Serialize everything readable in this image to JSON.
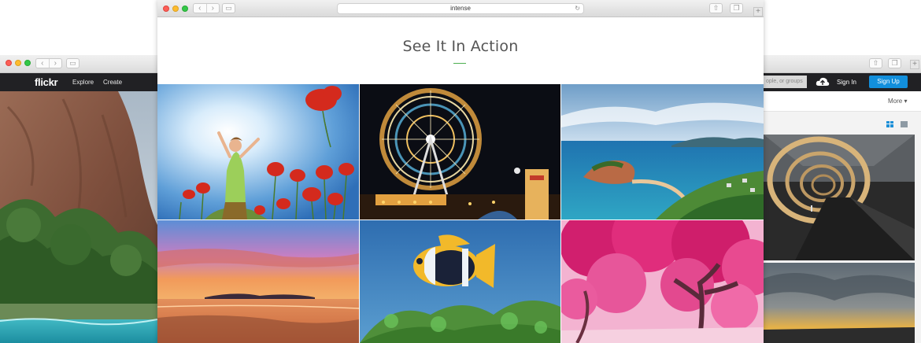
{
  "back_window": {
    "flickr": {
      "logo": "flickr",
      "nav": [
        "Explore",
        "Create"
      ],
      "search_placeholder": "ople, or groups",
      "sign_in": "Sign In",
      "sign_up": "Sign Up",
      "more": "More ▾"
    }
  },
  "front_window": {
    "url": "intense",
    "heading": "See It In Action",
    "accent_color": "#4caf50",
    "gallery": [
      "poppy-field-photo",
      "ferris-wheel-photo",
      "island-coast-photo",
      "sunset-beach-photo",
      "clownfish-photo",
      "pink-tree-photo"
    ]
  },
  "icons": [
    "back-chevron",
    "forward-chevron",
    "sidebar",
    "share",
    "tabs",
    "plus",
    "reload",
    "cloud-upload",
    "layout-grid"
  ]
}
